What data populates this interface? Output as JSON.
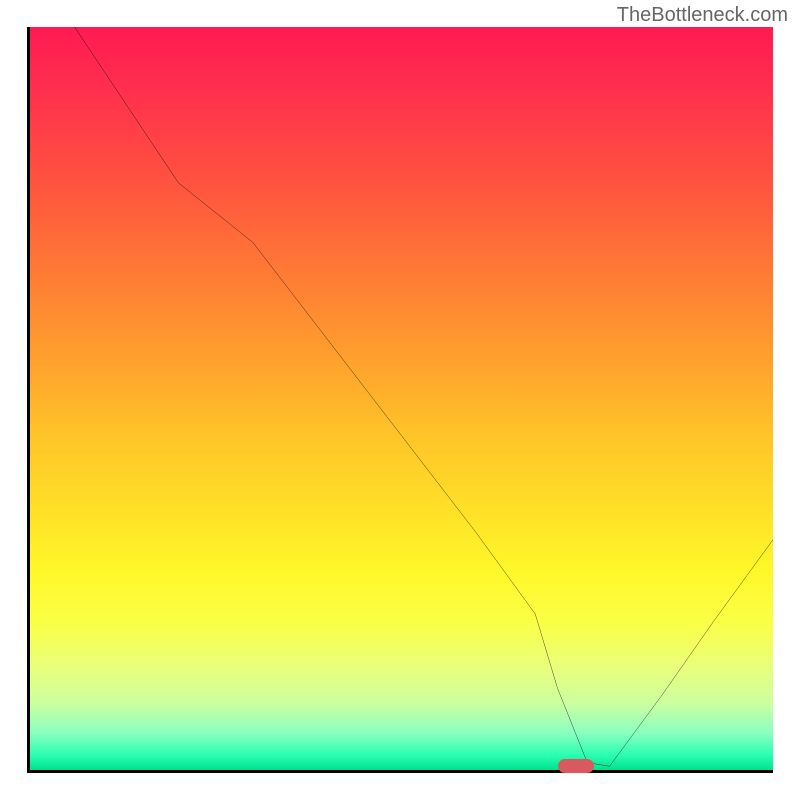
{
  "watermark": "TheBottleneck.com",
  "chart_data": {
    "type": "line",
    "title": "",
    "xlabel": "",
    "ylabel": "",
    "x_range": [
      0,
      100
    ],
    "y_range": [
      0,
      100
    ],
    "series": [
      {
        "name": "curve",
        "x": [
          6,
          10,
          20,
          30,
          40,
          50,
          60,
          68,
          71,
          75,
          78,
          85,
          92,
          100
        ],
        "y": [
          100,
          94,
          79,
          71,
          58,
          45,
          32,
          21,
          11,
          1,
          0.5,
          10,
          20,
          31
        ]
      }
    ],
    "marker": {
      "x": 73.5,
      "y": 0.5
    },
    "gradient_stops": [
      {
        "pos": 0,
        "color": "#ff1a52"
      },
      {
        "pos": 50,
        "color": "#ffc428"
      },
      {
        "pos": 80,
        "color": "#fbff45"
      },
      {
        "pos": 100,
        "color": "#00e090"
      }
    ]
  }
}
